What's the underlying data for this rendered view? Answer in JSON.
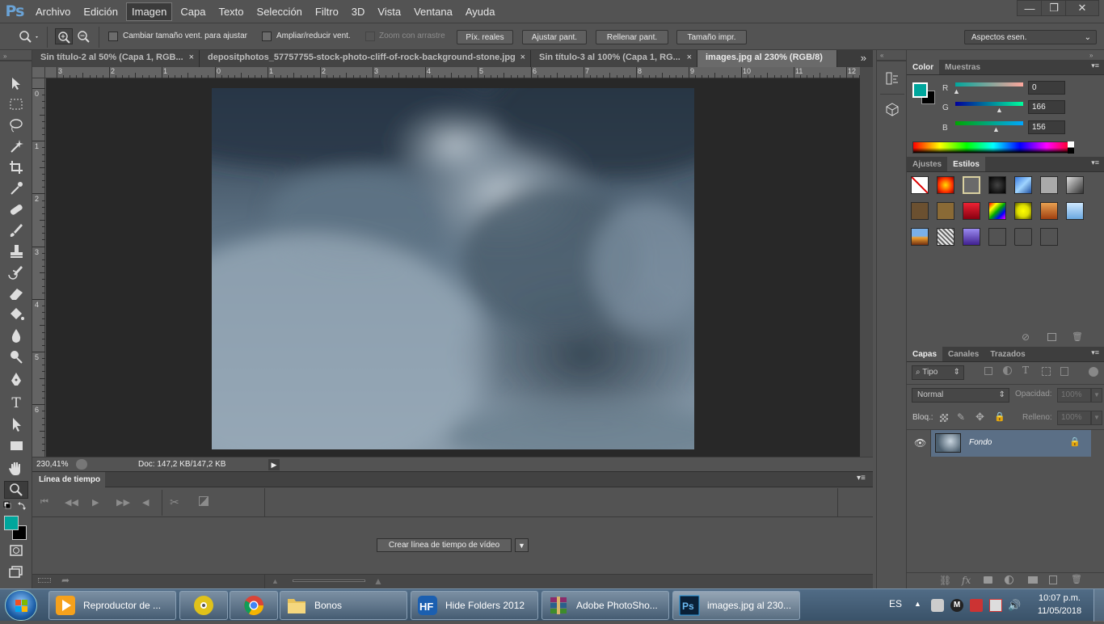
{
  "app": {
    "logo": "Ps"
  },
  "menu": [
    "Archivo",
    "Edición",
    "Imagen",
    "Capa",
    "Texto",
    "Selección",
    "Filtro",
    "3D",
    "Vista",
    "Ventana",
    "Ayuda"
  ],
  "window_controls": {
    "minimize": "—",
    "restore": "❐",
    "close": "✕"
  },
  "options": {
    "resize_windows_label": "Cambiar tamaño vent. para ajustar",
    "zoom_all_label": "Ampliar/reducir vent.",
    "scrubby_zoom_label": "Zoom con arrastre",
    "actual_pixels": "Píx. reales",
    "fit_screen": "Ajustar pant.",
    "fill_screen": "Rellenar pant.",
    "print_size": "Tamaño impr.",
    "workspace": "Aspectos esen."
  },
  "tabs": [
    {
      "label": "Sin título-2 al 50% (Capa 1, RGB..."
    },
    {
      "label": "depositphotos_57757755-stock-photo-cliff-of-rock-background-stone.jpg"
    },
    {
      "label": "Sin título-3 al 100% (Capa 1, RG..."
    },
    {
      "label": "images.jpg al 230% (RGB/8)"
    }
  ],
  "tab_close": "×",
  "tab_overflow": "»",
  "ruler": {
    "h": [
      "3",
      "2",
      "1",
      "0",
      "1",
      "2",
      "3",
      "4",
      "5",
      "6",
      "7",
      "8",
      "9",
      "10",
      "11",
      "12"
    ],
    "v": [
      "0",
      "1",
      "2",
      "3",
      "4",
      "5",
      "6"
    ]
  },
  "status": {
    "zoom": "230,41%",
    "doc": "Doc: 147,2 KB/147,2 KB"
  },
  "timeline": {
    "title": "Línea de tiempo",
    "create_button": "Crear línea de tiempo de vídeo"
  },
  "color_panel": {
    "tabs": [
      "Color",
      "Muestras"
    ],
    "r_label": "R",
    "g_label": "G",
    "b_label": "B",
    "r": "0",
    "g": "166",
    "b": "156",
    "foreground": "#00a69c"
  },
  "styles_panel": {
    "tabs": [
      "Ajustes",
      "Estilos"
    ]
  },
  "layers_panel": {
    "tabs": [
      "Capas",
      "Canales",
      "Trazados"
    ],
    "filter": "Tipo",
    "blend_mode": "Normal",
    "opacity_label": "Opacidad:",
    "opacity": "100%",
    "lock_label": "Bloq.:",
    "fill_label": "Relleno:",
    "fill": "100%",
    "layer_name": "Fondo"
  },
  "taskbar": {
    "items": [
      {
        "label": "Reproductor de ..."
      },
      {
        "label": ""
      },
      {
        "label": ""
      },
      {
        "label": "Bonos"
      },
      {
        "label": "Hide Folders 2012"
      },
      {
        "label": "Adobe PhotoSho..."
      },
      {
        "label": "images.jpg al 230..."
      }
    ],
    "lang": "ES",
    "time": "10:07 p.m.",
    "date": "11/05/2018"
  }
}
